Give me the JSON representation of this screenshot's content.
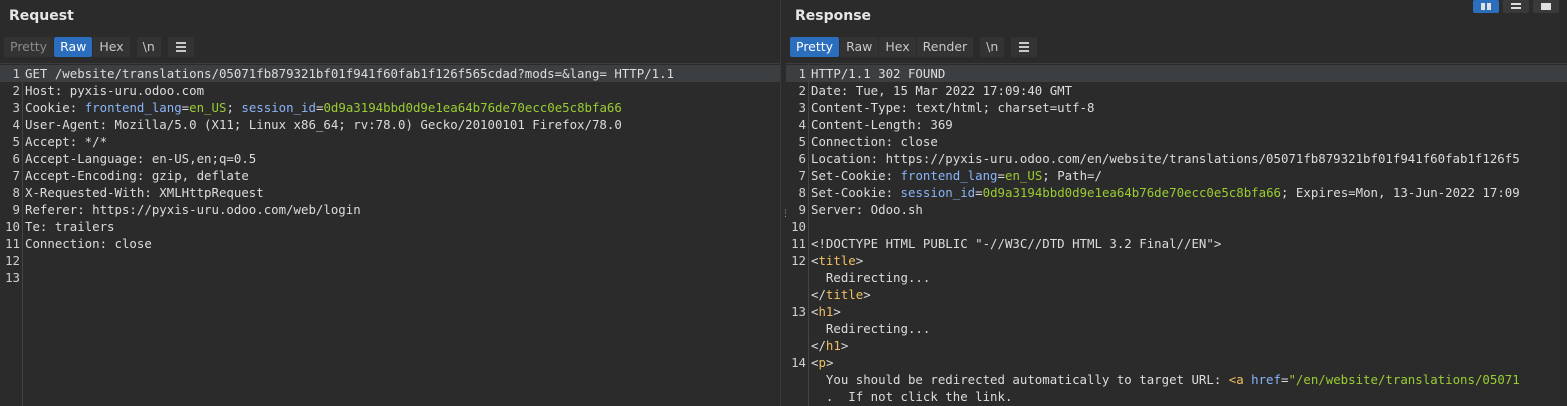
{
  "request": {
    "title": "Request",
    "tabs": [
      {
        "label": "Pretty",
        "state": "disabled"
      },
      {
        "label": "Raw",
        "state": "active"
      },
      {
        "label": "Hex",
        "state": "normal"
      },
      {
        "label": "\\n",
        "state": "normal"
      }
    ],
    "lines": [
      {
        "n": "1",
        "parts": [
          [
            "key",
            "GET /website/translations/05071fb879321bf01f941f60fab1f126f565cdad?mods=&lang= HTTP/1.1"
          ]
        ]
      },
      {
        "n": "2",
        "parts": [
          [
            "key",
            "Host: pyxis-uru.odoo.com"
          ]
        ]
      },
      {
        "n": "3",
        "parts": [
          [
            "key",
            "Cookie: "
          ],
          [
            "ckey",
            "frontend_lang"
          ],
          [
            "key",
            "="
          ],
          [
            "cval",
            "en_US"
          ],
          [
            "key",
            "; "
          ],
          [
            "ckey",
            "session_id"
          ],
          [
            "key",
            "="
          ],
          [
            "cval",
            "0d9a3194bbd0d9e1ea64b76de70ecc0e5c8bfa66"
          ]
        ]
      },
      {
        "n": "4",
        "parts": [
          [
            "key",
            "User-Agent: Mozilla/5.0 (X11; Linux x86_64; rv:78.0) Gecko/20100101 Firefox/78.0"
          ]
        ]
      },
      {
        "n": "5",
        "parts": [
          [
            "key",
            "Accept: */*"
          ]
        ]
      },
      {
        "n": "6",
        "parts": [
          [
            "key",
            "Accept-Language: en-US,en;q=0.5"
          ]
        ]
      },
      {
        "n": "7",
        "parts": [
          [
            "key",
            "Accept-Encoding: gzip, deflate"
          ]
        ]
      },
      {
        "n": "8",
        "parts": [
          [
            "key",
            "X-Requested-With: XMLHttpRequest"
          ]
        ]
      },
      {
        "n": "9",
        "parts": [
          [
            "key",
            "Referer: https://pyxis-uru.odoo.com/web/login"
          ]
        ]
      },
      {
        "n": "10",
        "parts": [
          [
            "key",
            "Te: trailers"
          ]
        ]
      },
      {
        "n": "11",
        "parts": [
          [
            "key",
            "Connection: close"
          ]
        ]
      },
      {
        "n": "12",
        "parts": []
      },
      {
        "n": "13",
        "parts": []
      }
    ]
  },
  "response": {
    "title": "Response",
    "tabs": [
      {
        "label": "Pretty",
        "state": "active"
      },
      {
        "label": "Raw",
        "state": "normal"
      },
      {
        "label": "Hex",
        "state": "normal"
      },
      {
        "label": "Render",
        "state": "normal"
      },
      {
        "label": "\\n",
        "state": "normal"
      }
    ],
    "lines": [
      {
        "n": "1",
        "parts": [
          [
            "key",
            "HTTP/1.1 302 FOUND"
          ]
        ]
      },
      {
        "n": "2",
        "parts": [
          [
            "key",
            "Date: Tue, 15 Mar 2022 17:09:40 GMT"
          ]
        ]
      },
      {
        "n": "3",
        "parts": [
          [
            "key",
            "Content-Type: text/html; charset=utf-8"
          ]
        ]
      },
      {
        "n": "4",
        "parts": [
          [
            "key",
            "Content-Length: 369"
          ]
        ]
      },
      {
        "n": "5",
        "parts": [
          [
            "key",
            "Connection: close"
          ]
        ]
      },
      {
        "n": "6",
        "parts": [
          [
            "key",
            "Location: https://pyxis-uru.odoo.com/en/website/translations/05071fb879321bf01f941f60fab1f126f5"
          ]
        ]
      },
      {
        "n": "7",
        "parts": [
          [
            "key",
            "Set-Cookie: "
          ],
          [
            "ckey",
            "frontend_lang"
          ],
          [
            "key",
            "="
          ],
          [
            "cval",
            "en_US"
          ],
          [
            "key",
            "; Path=/"
          ]
        ]
      },
      {
        "n": "8",
        "parts": [
          [
            "key",
            "Set-Cookie: "
          ],
          [
            "ckey",
            "session_id"
          ],
          [
            "key",
            "="
          ],
          [
            "cval",
            "0d9a3194bbd0d9e1ea64b76de70ecc0e5c8bfa66"
          ],
          [
            "key",
            "; Expires=Mon, 13-Jun-2022 17:09"
          ]
        ]
      },
      {
        "n": "9",
        "parts": [
          [
            "key",
            "Server: Odoo.sh"
          ]
        ]
      },
      {
        "n": "10",
        "parts": []
      },
      {
        "n": "11",
        "parts": [
          [
            "key",
            "<!DOCTYPE HTML PUBLIC \"-//W3C//DTD HTML 3.2 Final//EN\">"
          ]
        ]
      },
      {
        "n": "12",
        "parts": [
          [
            "key",
            "<"
          ],
          [
            "tag",
            "title"
          ],
          [
            "key",
            ">"
          ]
        ]
      },
      {
        "n": "",
        "parts": [
          [
            "key",
            "  Redirecting..."
          ]
        ]
      },
      {
        "n": "",
        "parts": [
          [
            "key",
            "</"
          ],
          [
            "tag",
            "title"
          ],
          [
            "key",
            ">"
          ]
        ]
      },
      {
        "n": "13",
        "parts": [
          [
            "key",
            "<"
          ],
          [
            "tag",
            "h1"
          ],
          [
            "key",
            ">"
          ]
        ]
      },
      {
        "n": "",
        "parts": [
          [
            "key",
            "  Redirecting..."
          ]
        ]
      },
      {
        "n": "",
        "parts": [
          [
            "key",
            "</"
          ],
          [
            "tag",
            "h1"
          ],
          [
            "key",
            ">"
          ]
        ]
      },
      {
        "n": "14",
        "parts": [
          [
            "key",
            "<"
          ],
          [
            "tag",
            "p"
          ],
          [
            "key",
            ">"
          ]
        ]
      },
      {
        "n": "",
        "parts": [
          [
            "key",
            "  You should be redirected automatically to target URL: "
          ],
          [
            "tag",
            "<a "
          ],
          [
            "attr",
            "href"
          ],
          [
            "key",
            "="
          ],
          [
            "cval",
            "\"/en/website/translations/05071"
          ]
        ]
      },
      {
        "n": "",
        "parts": [
          [
            "key",
            "  .  If not click the link."
          ]
        ]
      }
    ]
  },
  "view_buttons": [
    {
      "name": "split-horizontal-view-icon",
      "state": "active"
    },
    {
      "name": "split-vertical-view-icon",
      "state": "normal"
    },
    {
      "name": "single-view-icon",
      "state": "normal"
    }
  ],
  "colors": {
    "accent": "#2a6ebd",
    "cookie_key": "#8ab4f8",
    "cookie_value": "#9acd32",
    "tag": "#f0c060"
  }
}
